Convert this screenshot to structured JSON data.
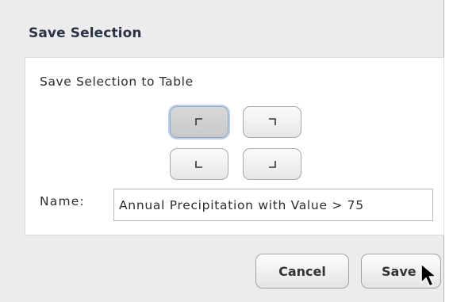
{
  "dialog": {
    "title": "Save Selection"
  },
  "panel": {
    "heading": "Save Selection to Table",
    "corner_buttons": [
      {
        "name": "top-left",
        "selected": true
      },
      {
        "name": "top-right",
        "selected": false
      },
      {
        "name": "bottom-left",
        "selected": false
      },
      {
        "name": "bottom-right",
        "selected": false
      }
    ],
    "name_label": "Name:",
    "name_value": "Annual Precipitation with Value > 75"
  },
  "actions": {
    "cancel_label": "Cancel",
    "save_label": "Save"
  },
  "icons": {
    "cursor": "arrow-cursor-icon"
  }
}
